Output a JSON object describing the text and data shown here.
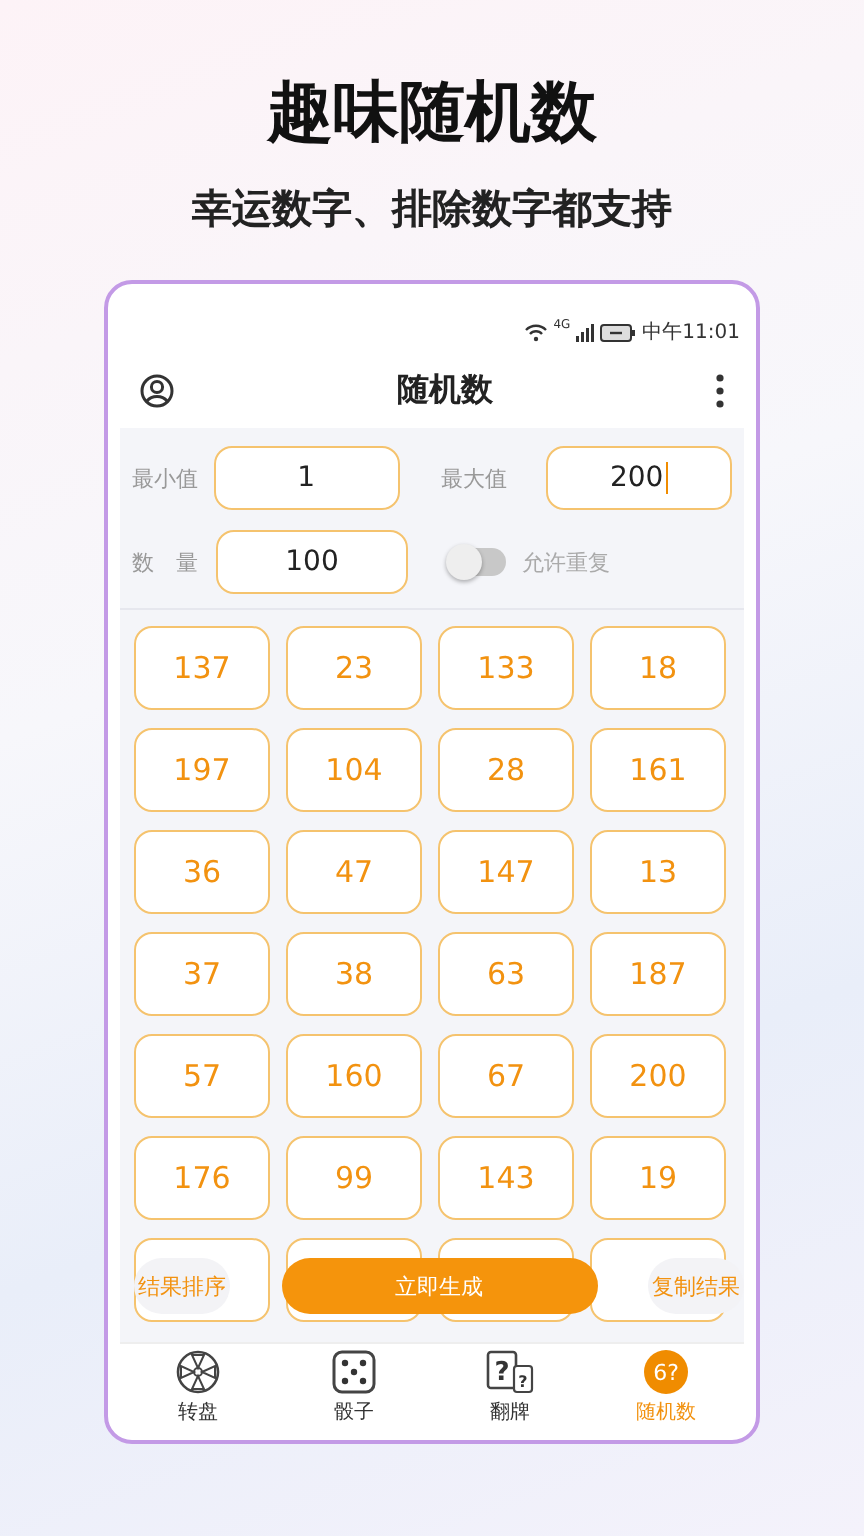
{
  "headline": "趣味随机数",
  "subtitle": "幸运数字、排除数字都支持",
  "status_bar": {
    "time": "中午11:01",
    "network": "4G"
  },
  "app_bar": {
    "title": "随机数"
  },
  "form": {
    "min_label": "最小值",
    "min_value": "1",
    "max_label": "最大值",
    "max_value": "200",
    "count_label": "数　量",
    "count_value": "100",
    "repeat_label": "允许重复",
    "repeat_on": false
  },
  "numbers": [
    "137",
    "23",
    "133",
    "18",
    "197",
    "104",
    "28",
    "161",
    "36",
    "47",
    "147",
    "13",
    "37",
    "38",
    "63",
    "187",
    "57",
    "160",
    "67",
    "200",
    "176",
    "99",
    "143",
    "19"
  ],
  "obscured_cells": [
    {
      "kind": "cell"
    },
    {
      "kind": "cell"
    },
    {
      "kind": "cell"
    },
    {
      "kind": "cell"
    }
  ],
  "actions": {
    "sort": "结果排序",
    "generate": "立即生成",
    "copy": "复制结果"
  },
  "nav": [
    {
      "kind": "wheel",
      "label": "转盘",
      "selected": false
    },
    {
      "kind": "dice",
      "label": "骰子",
      "selected": false
    },
    {
      "kind": "cards",
      "label": "翻牌",
      "selected": false,
      "icon_text": "?"
    },
    {
      "kind": "number",
      "label": "随机数",
      "selected": true,
      "icon_text": "6?"
    }
  ]
}
